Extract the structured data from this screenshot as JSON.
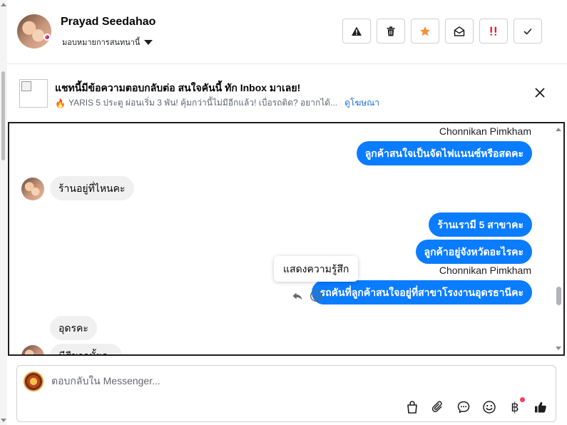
{
  "header": {
    "user_name": "Prayad Seedahao",
    "assign_label": "มอบหมายการสนทนานี้",
    "actions": [
      {
        "name": "report-button",
        "icon": "warning-icon"
      },
      {
        "name": "delete-button",
        "icon": "trash-icon"
      },
      {
        "name": "star-button",
        "icon": "star-icon",
        "color": "#f5923a"
      },
      {
        "name": "mark-unread-button",
        "icon": "envelope-open-icon"
      },
      {
        "name": "spam-button",
        "icon": "exclamation-icon",
        "color": "#e41e3f"
      },
      {
        "name": "done-button",
        "icon": "check-icon"
      }
    ]
  },
  "ad": {
    "title": "แชทนี้มีข้อความตอบกลับต่อ สนใจคันนี้ ทัก Inbox มาเลย!",
    "subtitle": "YARIS 5 ประตู ผ่อนเริ่ม 3 พัน! คุ้มกว่านี้ไม่มีอีกแล้ว! เบื่อรถติด? อยากได้...",
    "link": "ดูโฆษณา"
  },
  "chat": {
    "messages": [
      {
        "direction": "out",
        "sender": "Chonnikan Pimkham",
        "text": "ลูกค้าสนใจเป็นจัดไฟแนนซ์หรือสดคะ"
      },
      {
        "direction": "in",
        "text": "ร้านอยู่ที่ไหนคะ"
      },
      {
        "direction": "out",
        "text": "ร้านเรามี 5 สาขาคะ"
      },
      {
        "direction": "out",
        "text": "ลูกค้าอยู่จังหวัดอะไรคะ"
      },
      {
        "direction": "out",
        "sender": "Chonnikan Pimkham",
        "text": "รถคันที่ลูกค้าสนใจอยู่ที่สาขาโรงงานอุดรธานีคะ"
      },
      {
        "direction": "in",
        "text": "อุดรคะ"
      },
      {
        "direction": "in",
        "text": "มีสีขาวมั้ยคะ"
      }
    ],
    "tooltip": "แสดงความรู้สึก"
  },
  "composer": {
    "placeholder": "ตอบกลับใน Messenger...",
    "icons": [
      "shopping-bag-icon",
      "paperclip-icon",
      "saved-reply-icon",
      "emoji-icon",
      "baht-payment-icon",
      "thumbs-up-icon"
    ],
    "baht_symbol": "฿"
  }
}
